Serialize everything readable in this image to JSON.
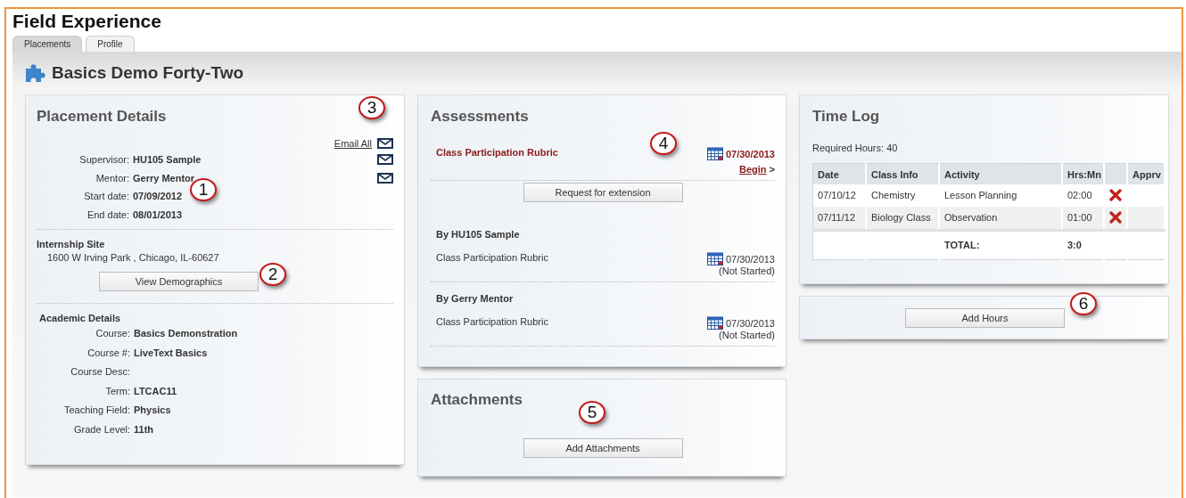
{
  "title": "Field Experience",
  "tabs": [
    {
      "label": "Placements",
      "selected": true
    },
    {
      "label": "Profile",
      "selected": false
    }
  ],
  "page_heading": "Basics Demo Forty-Two",
  "placement_details": {
    "title": "Placement Details",
    "email_all": "Email All",
    "people": [
      {
        "label": "Supervisor:",
        "value": "HU105 Sample",
        "email": true
      },
      {
        "label": "Mentor:",
        "value": "Gerry Mentor",
        "email": true
      },
      {
        "label": "Start date:",
        "value": "07/09/2012",
        "email": false
      },
      {
        "label": "End date:",
        "value": "08/01/2013",
        "email": false
      }
    ],
    "internship_site": {
      "title": "Internship Site",
      "address": "1600 W Irving Park , Chicago, IL-60627"
    },
    "demographics_button": "View Demographics",
    "academic_details": {
      "title": "Academic Details",
      "fields": [
        {
          "label": "Course:",
          "value": "Basics Demonstration"
        },
        {
          "label": "Course #:",
          "value": "LiveText Basics"
        },
        {
          "label": "Course Desc:"
        },
        {
          "label": "Term:",
          "value": "LTCAC11"
        },
        {
          "label": "Teaching Field:",
          "value": "Physics"
        },
        {
          "label": "Grade Level:",
          "value": "11th"
        }
      ]
    }
  },
  "assessments": {
    "title": "Assessments",
    "pending": {
      "name": "Class Participation Rubric",
      "due": "07/30/2013",
      "action": "Begin",
      "action_suffix": ">",
      "button": "Request for extension"
    },
    "groups": [
      {
        "heading": "By HU105 Sample",
        "items": [
          {
            "name": "Class Participation Rubric",
            "due": "07/30/2013",
            "status": "(Not Started)"
          }
        ]
      },
      {
        "heading": "By Gerry Mentor",
        "items": [
          {
            "name": "Class Participation Rubric",
            "due": "07/30/2013",
            "status": "(Not Started)"
          }
        ]
      }
    ]
  },
  "attachments": {
    "title": "Attachments",
    "button": "Add Attachments"
  },
  "time_log": {
    "title": "Time Log",
    "required": "Required Hours: 40",
    "columns": [
      "Date",
      "Class Info",
      "Activity",
      "Hrs:Mn",
      "Apprv"
    ],
    "rows": [
      {
        "date": "07/10/12",
        "class_info": "Chemistry",
        "activity": "Lesson Planning",
        "hours": "02:00",
        "deletable": true
      },
      {
        "date": "07/11/12",
        "class_info": "Biology Class",
        "activity": "Observation",
        "hours": "01:00",
        "deletable": true
      }
    ],
    "total": {
      "label": "TOTAL:",
      "hours": "3:0"
    }
  },
  "add_hours_button": "Add Hours",
  "callouts": [
    {
      "label": "1"
    },
    {
      "label": "2"
    },
    {
      "label": "3"
    },
    {
      "label": "4"
    },
    {
      "label": "5"
    },
    {
      "label": "6"
    }
  ]
}
